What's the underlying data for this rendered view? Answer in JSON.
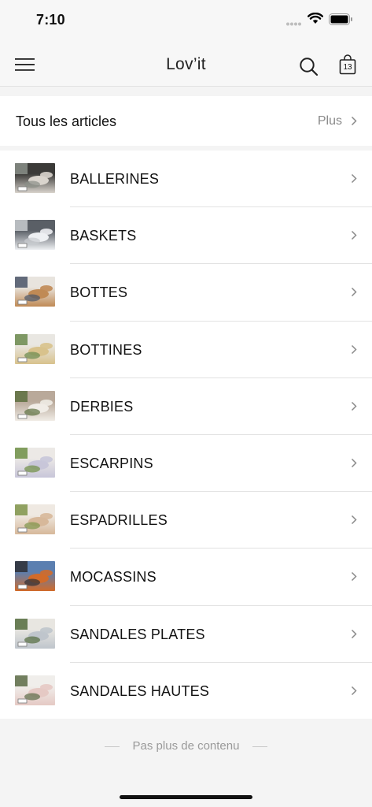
{
  "status_bar": {
    "time": "7:10"
  },
  "nav": {
    "title": "Lov’it",
    "cart_count": "13"
  },
  "section": {
    "title": "Tous les articles",
    "more_label": "Plus"
  },
  "categories": [
    {
      "label": "BALLERINES",
      "thumb_colors": [
        "#8a8f88",
        "#d9d4cd",
        "#3b3a38"
      ]
    },
    {
      "label": "BASKETS",
      "thumb_colors": [
        "#c9ccd0",
        "#eef0f3",
        "#5a5f66"
      ]
    },
    {
      "label": "BOTTES",
      "thumb_colors": [
        "#4a5568",
        "#c08a55",
        "#e8e4de"
      ]
    },
    {
      "label": "BOTTINES",
      "thumb_colors": [
        "#6b8a4e",
        "#d8c28c",
        "#e9e7e2"
      ]
    },
    {
      "label": "DERBIES",
      "thumb_colors": [
        "#5d7040",
        "#f0ece6",
        "#b9a99a"
      ]
    },
    {
      "label": "ESCARPINS",
      "thumb_colors": [
        "#6f8f45",
        "#c8c6d9",
        "#ece9e6"
      ]
    },
    {
      "label": "ESPADRILLES",
      "thumb_colors": [
        "#7f944a",
        "#d7b89a",
        "#efe9e2"
      ]
    },
    {
      "label": "MOCASSINS",
      "thumb_colors": [
        "#2f2f35",
        "#d16b2a",
        "#5b7fb0"
      ]
    },
    {
      "label": "SANDALES PLATES",
      "thumb_colors": [
        "#536b3d",
        "#bfc5cc",
        "#e8e6e1"
      ]
    },
    {
      "label": "SANDALES HAUTES",
      "thumb_colors": [
        "#5c6b47",
        "#e5c9c4",
        "#f0eeeb"
      ]
    }
  ],
  "footer": {
    "end_text": "Pas plus de contenu"
  },
  "icons": {
    "menu": "menu-icon",
    "search": "search-icon",
    "bag": "shopping-bag-icon",
    "chevron": "chevron-right-icon"
  },
  "colors": {
    "background": "#f4f4f4",
    "text": "#111111",
    "muted": "#8a8a8a"
  }
}
